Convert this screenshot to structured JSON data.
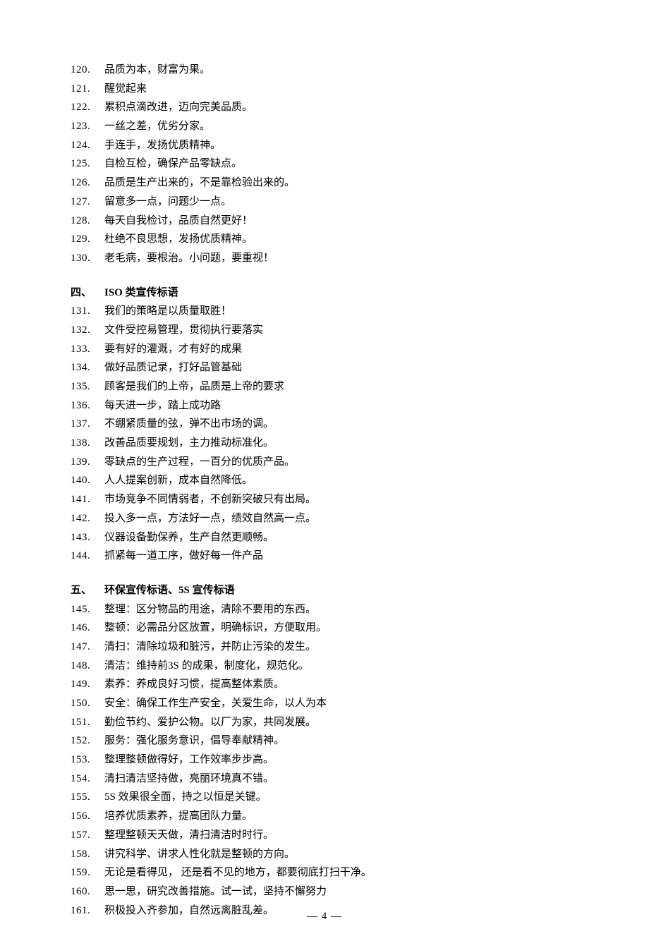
{
  "pageNumber": "— 4 —",
  "section3_items": [
    {
      "n": "120.",
      "t": "品质为本，财富为果。"
    },
    {
      "n": "121.",
      "t": "醒觉起来"
    },
    {
      "n": "122.",
      "t": "累积点滴改进，迈向完美品质。"
    },
    {
      "n": "123.",
      "t": "一丝之差，优劣分家。"
    },
    {
      "n": "124.",
      "t": "手连手，发扬优质精神。"
    },
    {
      "n": "125.",
      "t": "自检互检，确保产品零缺点。"
    },
    {
      "n": "126.",
      "t": "品质是生产出来的，不是靠检验出来的。"
    },
    {
      "n": "127.",
      "t": "留意多一点，问题少一点。"
    },
    {
      "n": "128.",
      "t": "每天自我检讨，品质自然更好！"
    },
    {
      "n": "129.",
      "t": "杜绝不良思想，发扬优质精神。"
    },
    {
      "n": "130.",
      "t": "老毛病，要根治。小问题，要重视！"
    }
  ],
  "section4_heading": {
    "n": "四、",
    "t": "ISO 类宣传标语"
  },
  "section4_items": [
    {
      "n": "131.",
      "t": "我们的策略是以质量取胜！"
    },
    {
      "n": "132.",
      "t": "文件受控易管理，贯彻执行要落实"
    },
    {
      "n": "133.",
      "t": "要有好的灌溉，才有好的成果"
    },
    {
      "n": "134.",
      "t": "做好品质记录，打好品管基础"
    },
    {
      "n": "135.",
      "t": "顾客是我们的上帝，品质是上帝的要求"
    },
    {
      "n": "136.",
      "t": "每天进一步，踏上成功路"
    },
    {
      "n": "137.",
      "t": "不绷紧质量的弦，弹不出市场的调。"
    },
    {
      "n": "138.",
      "t": "改善品质要规划，主力推动标准化。"
    },
    {
      "n": "139.",
      "t": "零缺点的生产过程，一百分的优质产品。"
    },
    {
      "n": "140.",
      "t": "人人提案创新，成本自然降低。"
    },
    {
      "n": "141.",
      "t": "市场竞争不同情弱者，不创新突破只有出局。"
    },
    {
      "n": "142.",
      "t": "投入多一点，方法好一点，绩效自然高一点。"
    },
    {
      "n": "143.",
      "t": "仪器设备勤保养，生产自然更顺畅。"
    },
    {
      "n": "144.",
      "t": "抓紧每一道工序，做好每一件产品"
    }
  ],
  "section5_heading": {
    "n": "五、",
    "t": "环保宣传标语、5S 宣传标语"
  },
  "section5_items": [
    {
      "n": "145.",
      "t": "整理：区分物品的用途，清除不要用的东西。"
    },
    {
      "n": "146.",
      "t": "整顿：必需品分区放置，明确标识，方便取用。"
    },
    {
      "n": "147.",
      "t": "清扫：清除垃圾和脏污，并防止污染的发生。"
    },
    {
      "n": "148.",
      "t": "清洁：维持前3S 的成果，制度化，规范化。"
    },
    {
      "n": "149.",
      "t": "素养：养成良好习惯，提高整体素质。"
    },
    {
      "n": "150.",
      "t": "安全：确保工作生产安全，关爱生命，以人为本"
    },
    {
      "n": "151.",
      "t": "勤俭节约、爱护公物。以厂为家，共同发展。"
    },
    {
      "n": "152.",
      "t": "服务：强化服务意识，倡导奉献精神。"
    },
    {
      "n": "153.",
      "t": "整理整顿做得好，工作效率步步高。"
    },
    {
      "n": "154.",
      "t": "清扫清洁坚持做，亮丽环境真不错。"
    },
    {
      "n": "155.",
      "t": "5S 效果很全面，持之以恒是关键。"
    },
    {
      "n": "156.",
      "t": "培养优质素养，提高团队力量。"
    },
    {
      "n": "157.",
      "t": "整理整顿天天做，清扫清洁时时行。"
    },
    {
      "n": "158.",
      "t": "讲究科学、讲求人性化就是整顿的方向。"
    },
    {
      "n": "159.",
      "t": "无论是看得见，  还是看不见的地方，都要彻底打扫干净。"
    },
    {
      "n": "160.",
      "t": "思一思，研究改善措施。试一试，坚持不懈努力"
    },
    {
      "n": "161.",
      "t": "积极投入齐参加，自然远离脏乱差。"
    }
  ]
}
